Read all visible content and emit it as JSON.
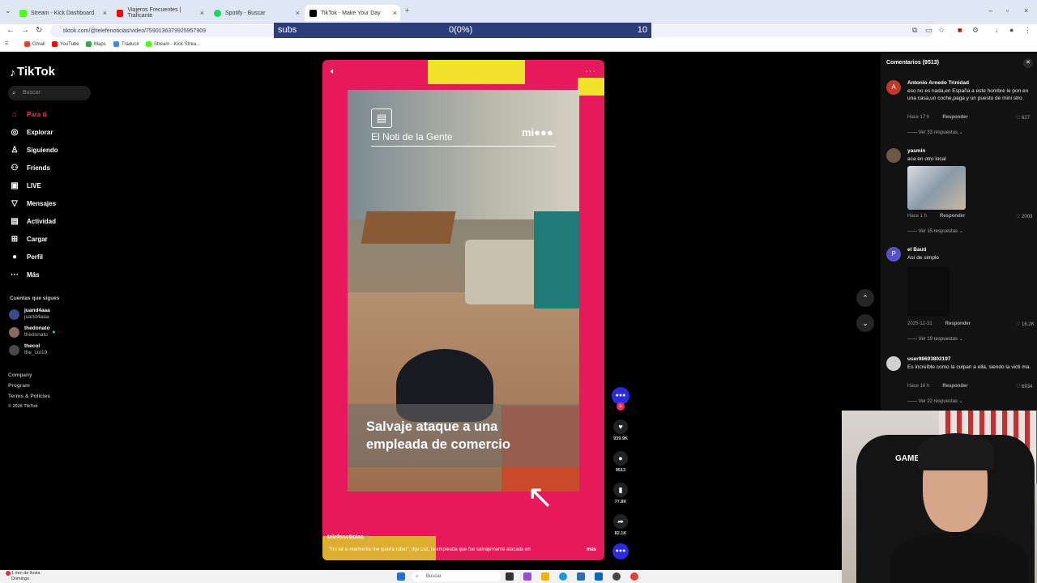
{
  "browser": {
    "tabs": [
      {
        "label": "Stream - Kick Dashboard",
        "color": "#53fc18"
      },
      {
        "label": "Viajeros Frecuentes | Traficante",
        "color": "#ff0000"
      },
      {
        "label": "Spotify - Buscar",
        "color": "#1ed760"
      },
      {
        "label": "TikTok - Make Your Day",
        "color": "#000000"
      }
    ],
    "url": "tiktok.com/@telefenoticias/video/7590136379925957909",
    "bookmarks": [
      {
        "label": "Gmail",
        "color": "#ea4335"
      },
      {
        "label": "YouTube",
        "color": "#ff0000"
      },
      {
        "label": "Maps",
        "color": "#34a853"
      },
      {
        "label": "Traducir",
        "color": "#4285f4"
      },
      {
        "label": "Stream - Kick Strea...",
        "color": "#53fc18"
      }
    ]
  },
  "overlay": {
    "label": "subs",
    "progress": "0(0%)",
    "goal": "10"
  },
  "sidebar": {
    "logo": "TikTok",
    "search_placeholder": "Buscar",
    "nav": [
      {
        "label": "Para ti",
        "icon": "home-icon"
      },
      {
        "label": "Explorar",
        "icon": "compass-icon"
      },
      {
        "label": "Siguiendo",
        "icon": "following-icon"
      },
      {
        "label": "Friends",
        "icon": "friends-icon"
      },
      {
        "label": "LIVE",
        "icon": "live-icon"
      },
      {
        "label": "Mensajes",
        "icon": "messages-icon"
      },
      {
        "label": "Actividad",
        "icon": "activity-icon"
      },
      {
        "label": "Cargar",
        "icon": "upload-icon"
      },
      {
        "label": "Perfil",
        "icon": "profile-icon"
      },
      {
        "label": "Más",
        "icon": "more-icon"
      }
    ],
    "following_title": "Cuentas que sigues",
    "following": [
      {
        "name": "juand4aaa",
        "handle": "juand4aaa"
      },
      {
        "name": "thedonato",
        "handle": "thedonato"
      },
      {
        "name": "thecol",
        "handle": "the_col19"
      }
    ],
    "footer": [
      "Company",
      "Program",
      "Terms & Policies",
      "© 2026 TikTok"
    ]
  },
  "video": {
    "brand": "El Noti de la Gente",
    "network": "mi",
    "caption_line1": "Salvaje ataque a una",
    "caption_line2": "empleada de comercio",
    "username": "telefenoticias",
    "description": "\"No sé si realmente me quería robar\", dijo Luz, la empleada que fue salvajemente atacada en",
    "more": "más",
    "likes": "939.9K",
    "comments": "9513",
    "saves": "77.8K",
    "shares": "82.1K"
  },
  "comments": {
    "title": "Comentarios (9513)",
    "items": [
      {
        "initial": "A",
        "color": "#c0392b",
        "name": "Antonio Arnedo Trinidad",
        "text": "eso no es nada,en España a este hombre le pon en una casa,un coche,paga y un puesto de mini stro",
        "time": "Hace 17 h",
        "reply": "Responder",
        "likes": "627",
        "replies": "Ver 33 respuestas"
      },
      {
        "initial": "",
        "color": "#6b5a4a",
        "name": "yasmin",
        "text": "aca en otro local",
        "time": "Hace 1 h",
        "reply": "Responder",
        "likes": "2003",
        "replies": "Ver 15 respuestas"
      },
      {
        "initial": "P",
        "color": "#5b4fc7",
        "name": "el Bauti",
        "text": "Así de simple",
        "time": "2025-12-31",
        "reply": "Responder",
        "likes": "16.2K",
        "replies": "Ver 19 respuestas"
      },
      {
        "initial": "",
        "color": "#999999",
        "name": "user98693802197",
        "text": "Es increíble como la culpan a ella, siendo la victi ma.",
        "time": "Hace 16 h",
        "reply": "Responder",
        "likes": "6934",
        "replies": "Ver 22 respuestas"
      }
    ]
  },
  "webcam": {
    "chair_text": "GAME"
  },
  "taskbar": {
    "weather_line1": "1 mm de lluvia",
    "weather_line2": "Domingo",
    "search": "Buscar"
  }
}
